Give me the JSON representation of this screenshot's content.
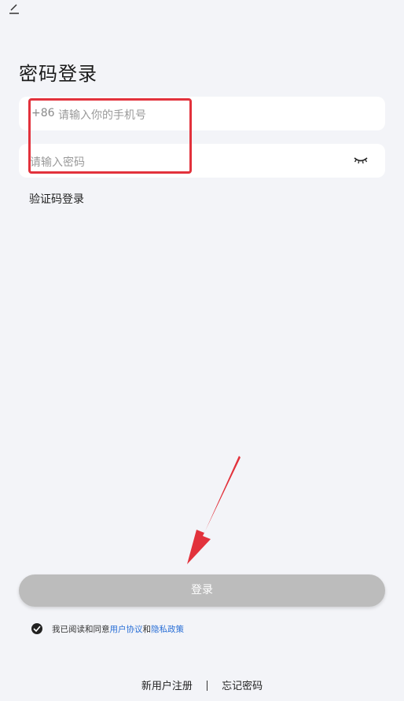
{
  "header": {
    "back_icon": "back-arrow-icon"
  },
  "title": "密码登录",
  "phone_field": {
    "country_code": "+86",
    "placeholder": "请输入你的手机号"
  },
  "password_field": {
    "placeholder": "请输入密码",
    "toggle_icon": "eye-closed-icon"
  },
  "sms_login_label": "验证码登录",
  "login_button": "登录",
  "agreement": {
    "prefix": "我已阅读和同意",
    "user_agreement": "用户协议",
    "conjunction": "和",
    "privacy_policy": "隐私政策"
  },
  "footer": {
    "register": "新用户注册",
    "forgot_password": "忘记密码"
  },
  "colors": {
    "background": "#f3f4f8",
    "link": "#2a6fd6",
    "annotation": "#e2323c",
    "button_disabled": "#bcbcbc"
  }
}
